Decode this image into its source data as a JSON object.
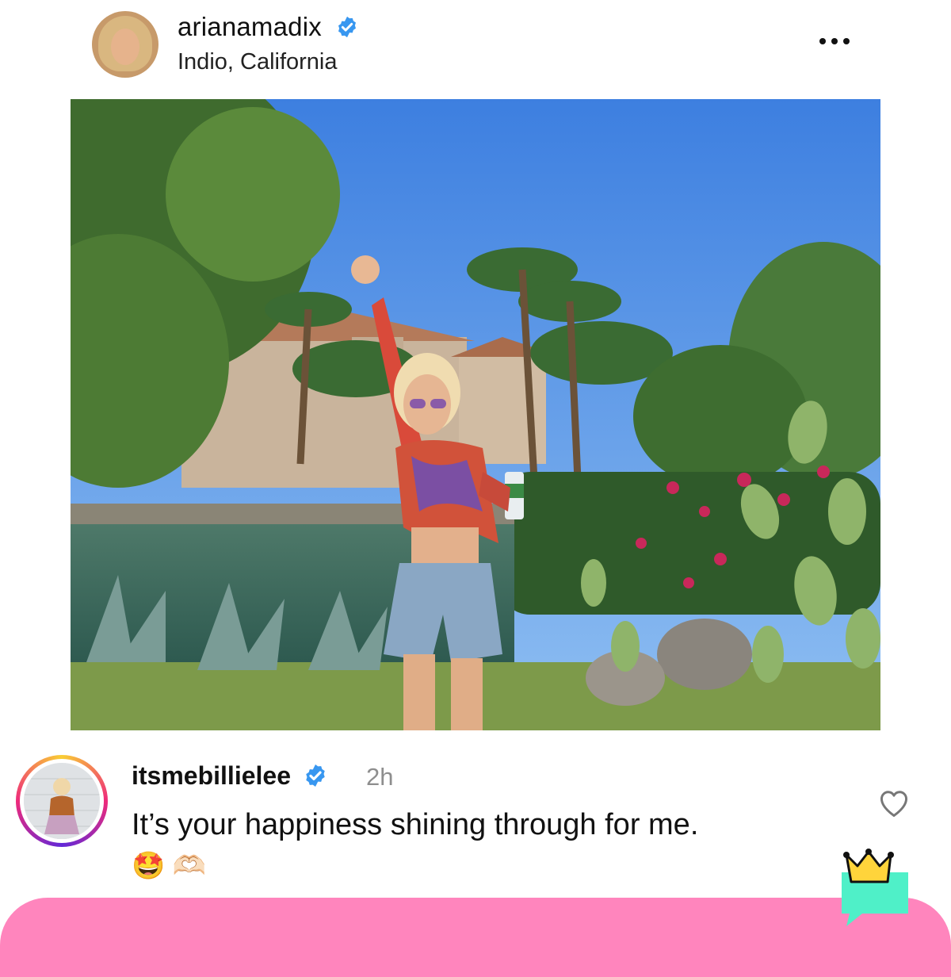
{
  "post": {
    "username": "arianamadix",
    "location": "Indio, California",
    "verified": true,
    "more_icon": "more-horizontal-icon"
  },
  "photo": {
    "image_description": "Woman in tie-dye crop top and denim shorts holding a can and making a peace sign in a desert garden with palm trees, a pond, and cacti"
  },
  "comment": {
    "username": "itsmebillielee",
    "verified": true,
    "time": "2h",
    "text": "It’s your happiness shining through for me.",
    "emoji": "🤩 🫶🏻",
    "like_icon": "heart-outline-icon"
  },
  "colors": {
    "verified_blue": "#3897f0",
    "pink_bar": "#ff85bd",
    "badge_teal": "#4ff0c8",
    "crown_yellow": "#ffd43b"
  }
}
